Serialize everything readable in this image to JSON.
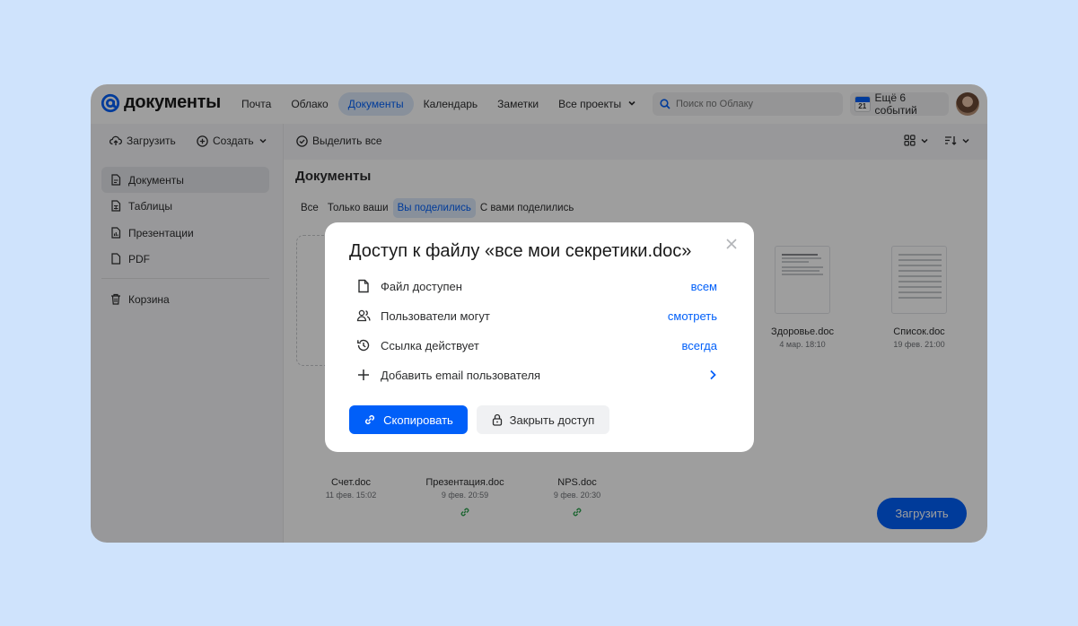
{
  "app": {
    "logo_text": "документы"
  },
  "nav": [
    {
      "label": "Почта"
    },
    {
      "label": "Облако"
    },
    {
      "label": "Документы",
      "active": true
    },
    {
      "label": "Календарь"
    },
    {
      "label": "Заметки"
    },
    {
      "label": "Все проекты",
      "dropdown": true
    }
  ],
  "search": {
    "placeholder": "Поиск по Облаку"
  },
  "events": {
    "day": "21",
    "label": "Ещё 6 событий"
  },
  "toolbar": {
    "upload_label": "Загрузить",
    "create_label": "Создать",
    "select_all_label": "Выделить все"
  },
  "sidebar": {
    "items": [
      {
        "label": "Документы",
        "icon": "document-icon",
        "active": true
      },
      {
        "label": "Таблицы",
        "icon": "table-icon"
      },
      {
        "label": "Презентации",
        "icon": "presentation-icon"
      },
      {
        "label": "PDF",
        "icon": "pdf-icon"
      }
    ],
    "trash_label": "Корзина"
  },
  "main": {
    "title": "Документы",
    "tabs": [
      {
        "label": "Все"
      },
      {
        "label": "Только ваши"
      },
      {
        "label": "Вы поделились",
        "active": true
      },
      {
        "label": "С вами поделились"
      }
    ],
    "files": [
      {
        "name": "Здоровье.doc",
        "date": "4 мар. 18:10"
      },
      {
        "name": "Список.doc",
        "date": "19 фев. 21:00"
      },
      {
        "name": "Счет.doc",
        "date": "11 фев. 15:02"
      },
      {
        "name": "Презентация.doc",
        "date": "9 фев. 20:59",
        "shared": true
      },
      {
        "name": "NPS.doc",
        "date": "9 фев. 20:30",
        "shared": true
      }
    ],
    "upload_fab_label": "Загрузить"
  },
  "modal": {
    "title": "Доступ к файлу «все мои секретики.doc»",
    "rows": [
      {
        "label": "Файл доступен",
        "value": "всем",
        "icon": "file-icon"
      },
      {
        "label": "Пользователи могут",
        "value": "смотреть",
        "icon": "users-icon"
      },
      {
        "label": "Ссылка действует",
        "value": "всегда",
        "icon": "history-icon"
      },
      {
        "label": "Добавить email пользователя",
        "value": "",
        "icon": "plus-icon"
      }
    ],
    "copy_button": "Скопировать",
    "close_access_button": "Закрыть доступ"
  },
  "colors": {
    "accent": "#005ff9",
    "background": "#cfe3fc",
    "shared_link": "#2ea44f"
  }
}
